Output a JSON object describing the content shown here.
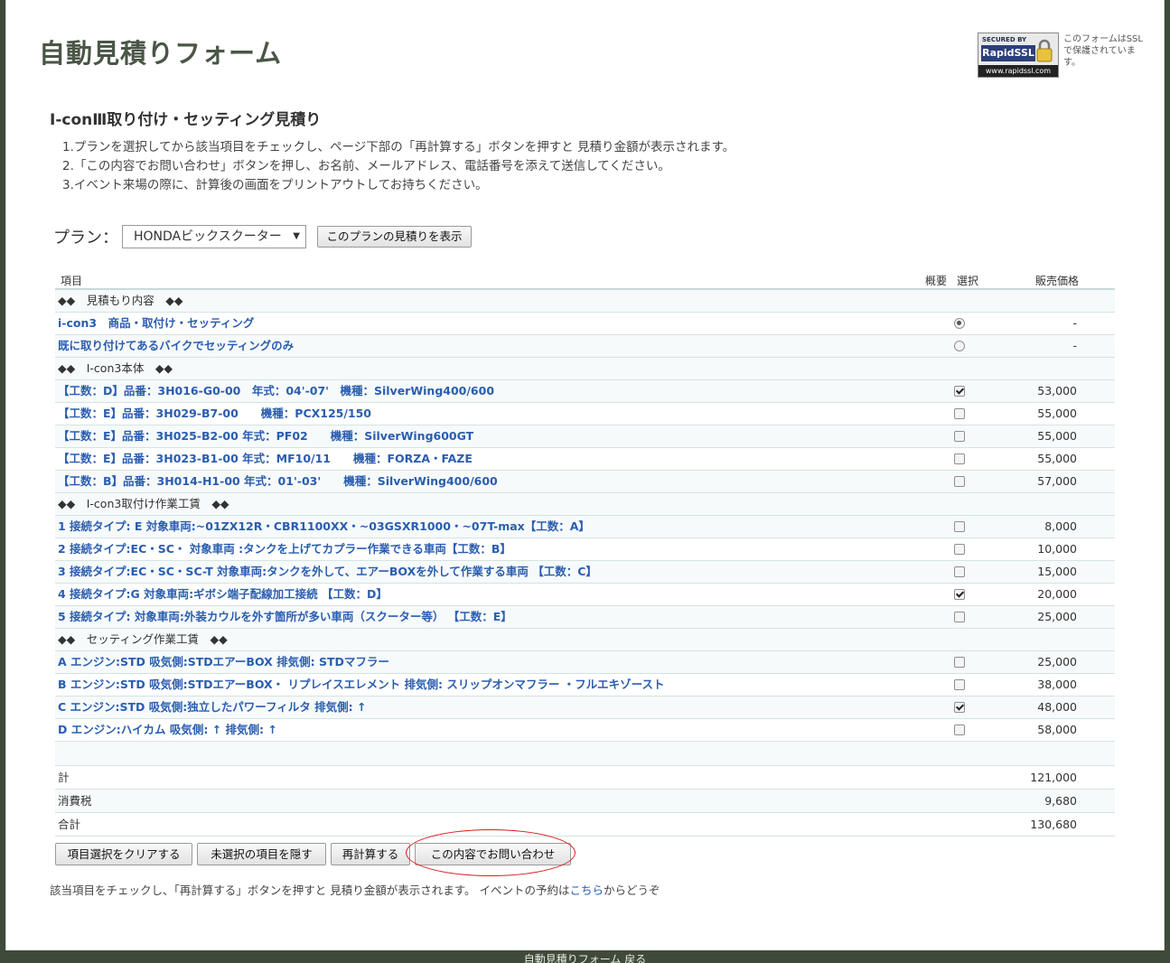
{
  "header": {
    "title": "自動見積りフォーム",
    "ssl": {
      "top_text": "SECURED BY",
      "brand": "RapidSSL",
      "url": "www.rapidssl.com",
      "note": "このフォームはSSLで保護されています。"
    }
  },
  "section_title": "I-conⅢ取り付け・セッティング見積り",
  "instructions": [
    "1.プランを選択してから該当項目をチェックし、ページ下部の「再計算する」ボタンを押すと 見積り金額が表示されます。",
    "2.「この内容でお問い合わせ」ボタンを押し、お名前、メールアドレス、電話番号を添えて送信してください。",
    "3.イベント来場の際に、計算後の画面をプリントアウトしてお持ちください。"
  ],
  "plan": {
    "label": "プラン：",
    "selected": "HONDAビックスクーター",
    "show_button": "このプランの見積りを表示"
  },
  "table": {
    "headers": {
      "item": "項目",
      "summary": "概要",
      "select": "選択",
      "price": "販売価格"
    },
    "rows": [
      {
        "type": "group",
        "label": "◆◆　見積もり内容　◆◆"
      },
      {
        "type": "item",
        "control": "radio",
        "checked": true,
        "label": "i-con3　商品・取付け・セッティング",
        "price": "-"
      },
      {
        "type": "item",
        "control": "radio",
        "checked": false,
        "label": "既に取り付けてあるバイクでセッティングのみ",
        "price": "-"
      },
      {
        "type": "group",
        "label": "◆◆　I-con3本体　◆◆"
      },
      {
        "type": "item",
        "control": "checkbox",
        "checked": true,
        "label": "【工数：D】品番：3H016-G0-00　年式：04'-07'　機種：SilverWing400/600",
        "price": "53,000"
      },
      {
        "type": "item",
        "control": "checkbox",
        "checked": false,
        "label": "【工数：E】品番：3H029-B7-00　　機種：PCX125/150",
        "price": "55,000"
      },
      {
        "type": "item",
        "control": "checkbox",
        "checked": false,
        "label": "【工数：E】品番：3H025-B2-00 年式：PF02　　機種：SilverWing600GT",
        "price": "55,000"
      },
      {
        "type": "item",
        "control": "checkbox",
        "checked": false,
        "label": "【工数：E】品番：3H023-B1-00 年式：MF10/11　　機種：FORZA・FAZE",
        "price": "55,000"
      },
      {
        "type": "item",
        "control": "checkbox",
        "checked": false,
        "label": "【工数：B】品番：3H014-H1-00 年式：01'-03'　　機種：SilverWing400/600",
        "price": "57,000"
      },
      {
        "type": "group",
        "label": "◆◆　I-con3取付け作業工賃　◆◆"
      },
      {
        "type": "item",
        "control": "checkbox",
        "checked": false,
        "label": "1 接続タイプ: E 対象車両:~01ZX12R・CBR1100XX・~03GSXR1000・~07T-max【工数：A】",
        "price": "8,000"
      },
      {
        "type": "item",
        "control": "checkbox",
        "checked": false,
        "label": "2 接続タイプ:EC・SC・ 対象車両 :タンクを上げてカプラー作業できる車両【工数：B】",
        "price": "10,000"
      },
      {
        "type": "item",
        "control": "checkbox",
        "checked": false,
        "label": "3 接続タイプ:EC・SC・SC-T 対象車両:タンクを外して、エアーBOXを外して作業する車両 【工数：C】",
        "price": "15,000"
      },
      {
        "type": "item",
        "control": "checkbox",
        "checked": true,
        "label": "4 接続タイプ:G 対象車両:ギボシ端子配線加工接続 【工数：D】",
        "price": "20,000"
      },
      {
        "type": "item",
        "control": "checkbox",
        "checked": false,
        "label": "5 接続タイプ: 対象車両:外装カウルを外す箇所が多い車両（スクーター等） 【工数：E】",
        "price": "25,000"
      },
      {
        "type": "group",
        "label": "◆◆　セッティング作業工賃　◆◆"
      },
      {
        "type": "item",
        "control": "checkbox",
        "checked": false,
        "label": "A エンジン:STD 吸気側:STDエアーBOX 排気側: STDマフラー",
        "price": "25,000"
      },
      {
        "type": "item",
        "control": "checkbox",
        "checked": false,
        "label": "B エンジン:STD 吸気側:STDエアーBOX・ リプレイスエレメント 排気側: スリップオンマフラー ・フルエキゾースト",
        "price": "38,000"
      },
      {
        "type": "item",
        "control": "checkbox",
        "checked": true,
        "label": "C エンジン:STD 吸気側:独立したパワーフィルタ 排気側: ↑",
        "price": "48,000"
      },
      {
        "type": "item",
        "control": "checkbox",
        "checked": false,
        "label": "D エンジン:ハイカム 吸気側: ↑ 排気側: ↑",
        "price": "58,000"
      }
    ],
    "totals": [
      {
        "label": "計",
        "value": "121,000"
      },
      {
        "label": "消費税",
        "value": "9,680"
      },
      {
        "label": "合計",
        "value": "130,680"
      }
    ]
  },
  "actions": {
    "clear": "項目選択をクリアする",
    "hide_unselected": "未選択の項目を隠す",
    "recalc": "再計算する",
    "inquire": "この内容でお問い合わせ"
  },
  "footnote": {
    "text": "該当項目をチェックし、「再計算する」ボタンを押すと 見積り金額が表示されます。 イベントの予約は",
    "link": "こちら",
    "suffix": "からどうぞ"
  },
  "footer": {
    "text": "自動見積りフォーム  戻る"
  },
  "colors": {
    "title": "#4a5646",
    "link": "#2a5db0",
    "highlight": "#d81c1c"
  }
}
